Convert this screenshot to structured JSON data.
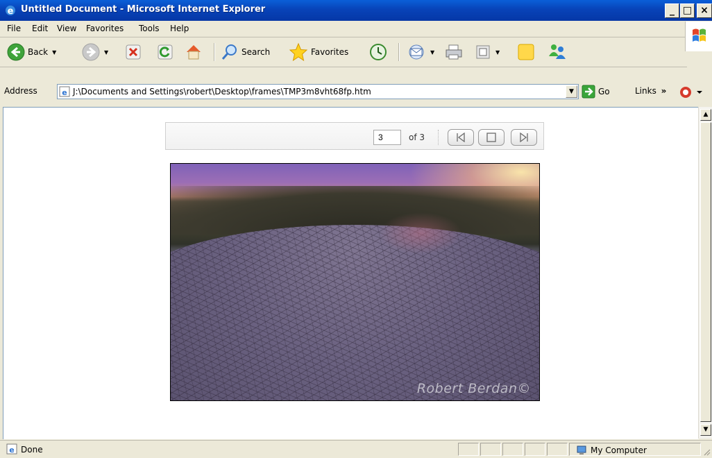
{
  "window": {
    "title": "Untitled Document - Microsoft Internet Explorer",
    "minimize": "_",
    "maximize": "□",
    "close": "×"
  },
  "menu": [
    "File",
    "Edit",
    "View",
    "Favorites",
    "Tools",
    "Help"
  ],
  "toolbar": {
    "back": "Back",
    "search": "Search",
    "favorites": "Favorites"
  },
  "address": {
    "label": "Address",
    "url": "J:\\Documents and Settings\\robert\\Desktop\\frames\\TMP3m8vht68fp.htm",
    "go": "Go",
    "links": "Links"
  },
  "gallery": {
    "current": "3",
    "of_text": "of 3"
  },
  "photo": {
    "credit": "Robert Berdan©"
  },
  "status": {
    "text": "Done",
    "zone": "My Computer"
  },
  "colors": {
    "title_blue": "#0843b8",
    "chrome": "#ece9d8"
  }
}
